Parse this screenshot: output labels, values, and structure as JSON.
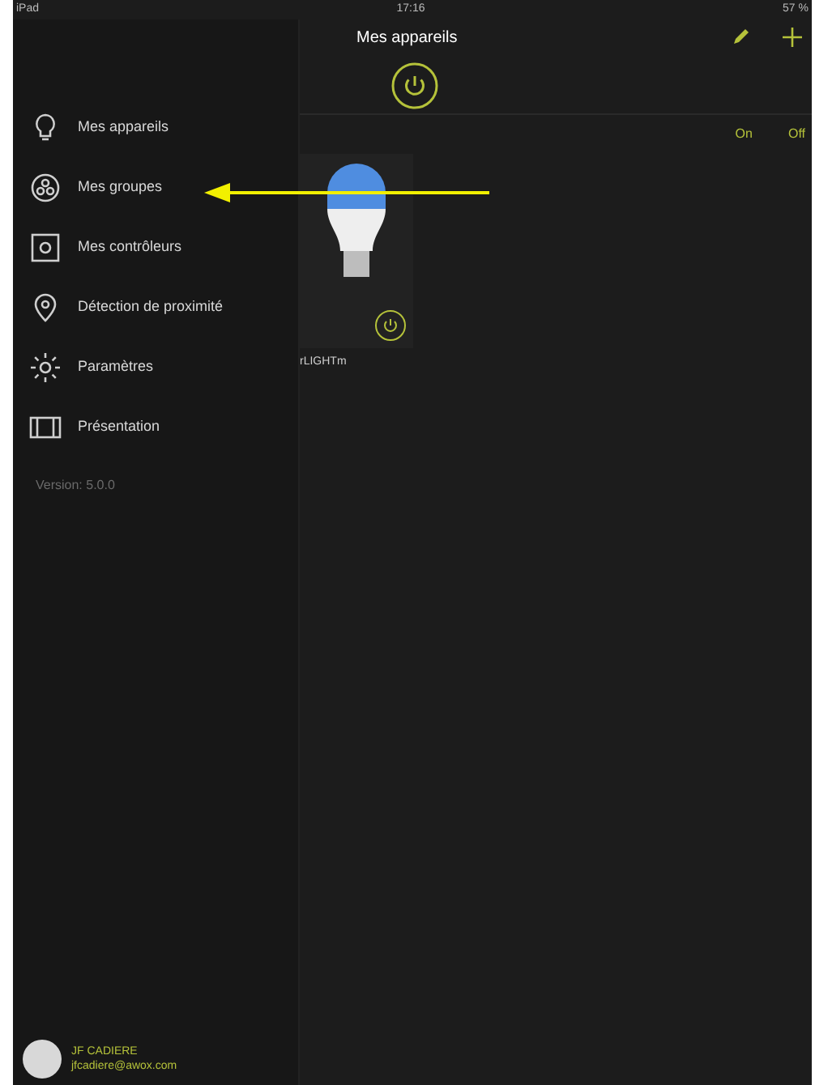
{
  "status_bar": {
    "device": "iPad",
    "time": "17:16",
    "battery": "57 %"
  },
  "header": {
    "title": "Mes appareils"
  },
  "toggle": {
    "on": "On",
    "off": "Off"
  },
  "device_card": {
    "name": "rLIGHTm"
  },
  "sidebar": {
    "items": [
      {
        "kind": "bulb",
        "label": "Mes appareils"
      },
      {
        "kind": "groups",
        "label": "Mes groupes"
      },
      {
        "kind": "controller",
        "label": "Mes contrôleurs"
      },
      {
        "kind": "pin",
        "label": "Détection de proximité"
      },
      {
        "kind": "gear",
        "label": "Paramètres"
      },
      {
        "kind": "screen",
        "label": "Présentation"
      }
    ],
    "version": "Version: 5.0.0",
    "user": {
      "name": "JF CADIERE",
      "email": "jfcadiere@awox.com"
    }
  }
}
